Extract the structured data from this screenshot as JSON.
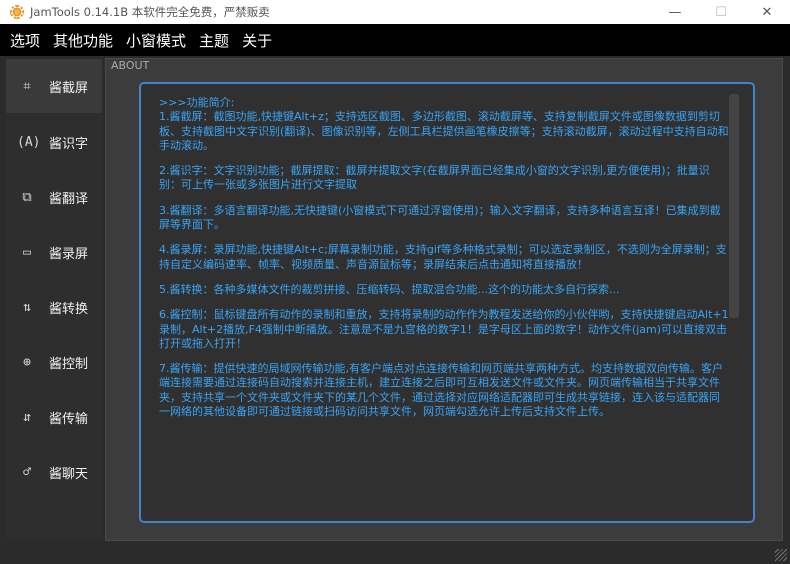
{
  "window": {
    "title": "JamTools 0.14.1B 本软件完全免费，严禁贩卖",
    "minimize_icon": "—",
    "maximize_icon": "☐",
    "close_icon": "✕"
  },
  "menu": {
    "items": [
      "选项",
      "其他功能",
      "小窗模式",
      "主题",
      "关于"
    ]
  },
  "sidebar": {
    "items": [
      {
        "icon": "crop-icon",
        "glyph": "⌗",
        "label": "酱截屏",
        "active": true
      },
      {
        "icon": "ocr-icon",
        "glyph": "(A)",
        "label": "酱识字",
        "active": false
      },
      {
        "icon": "translate-icon",
        "glyph": "⧉",
        "label": "酱翻译",
        "active": false
      },
      {
        "icon": "video-icon",
        "glyph": "▭",
        "label": "酱录屏",
        "active": false
      },
      {
        "icon": "convert-icon",
        "glyph": "⇅",
        "label": "酱转换",
        "active": false
      },
      {
        "icon": "control-icon",
        "glyph": "⊕",
        "label": "酱控制",
        "active": false
      },
      {
        "icon": "transfer-icon",
        "glyph": "⇵",
        "label": "酱传输",
        "active": false
      },
      {
        "icon": "chat-icon",
        "glyph": "♂",
        "label": "酱聊天",
        "active": false
      }
    ]
  },
  "content": {
    "section_label": "ABOUT",
    "paragraphs": [
      ">>>功能简介:\n1.酱截屏：截图功能,快捷键Alt+z；支持选区截图、多边形截图、滚动截屏等、支持复制截屏文件或图像数据到剪切板、支持截图中文字识别(翻译)、图像识别等，左侧工具栏提供画笔橡皮擦等；支持滚动截屏，滚动过程中支持自动和手动滚动。",
      "2.酱识字：文字识别功能；截屏提取：截屏并提取文字(在截屏界面已经集成小窗的文字识别,更方便使用)；批量识别：可上传一张或多张图片进行文字提取",
      "3.酱翻译：多语言翻译功能,无快捷键(小窗模式下可通过浮窗使用)；输入文字翻译，支持多种语言互译！已集成到截屏等界面下。",
      "4.酱录屏：录屏功能,快捷键Alt+c;屏幕录制功能，支持gif等多种格式录制；可以选定录制区，不选则为全屏录制；支持自定义编码速率、帧率、视频质量、声音源鼠标等；录屏结束后点击通知将直接播放！",
      "5.酱转换：各种多媒体文件的裁剪拼接、压缩转码、提取混合功能...这个的功能太多自行探索...",
      "6.酱控制：鼠标键盘所有动作的录制和重放，支持将录制的动作作为教程发送给你的小伙伴哟，支持快捷键启动Alt+1录制，Alt+2播放,F4强制中断播放。注意是不是九宫格的数字1！是字母区上面的数字！动作文件(jam)可以直接双击打开或拖入打开！",
      "7.酱传输：提供快速的局域网传输功能,有客户端点对点连接传输和网页端共享两种方式。均支持数据双向传输。客户端连接需要通过连接码自动搜索并连接主机，建立连接之后即可互相发送文件或文件夹。网页端传输相当于共享文件夹，支持共享一个文件夹或文件夹下的某几个文件，通过选择对应网络适配器即可生成共享链接，连入该与适配器同一网络的其他设备即可通过链接或扫码访问共享文件，网页端勾选允许上传后支持文件上传。"
    ]
  },
  "colors": {
    "accent": "#3e86c9",
    "text_blue": "#39a4f5",
    "menubar": "#000000",
    "background": "#2b2b2b"
  }
}
